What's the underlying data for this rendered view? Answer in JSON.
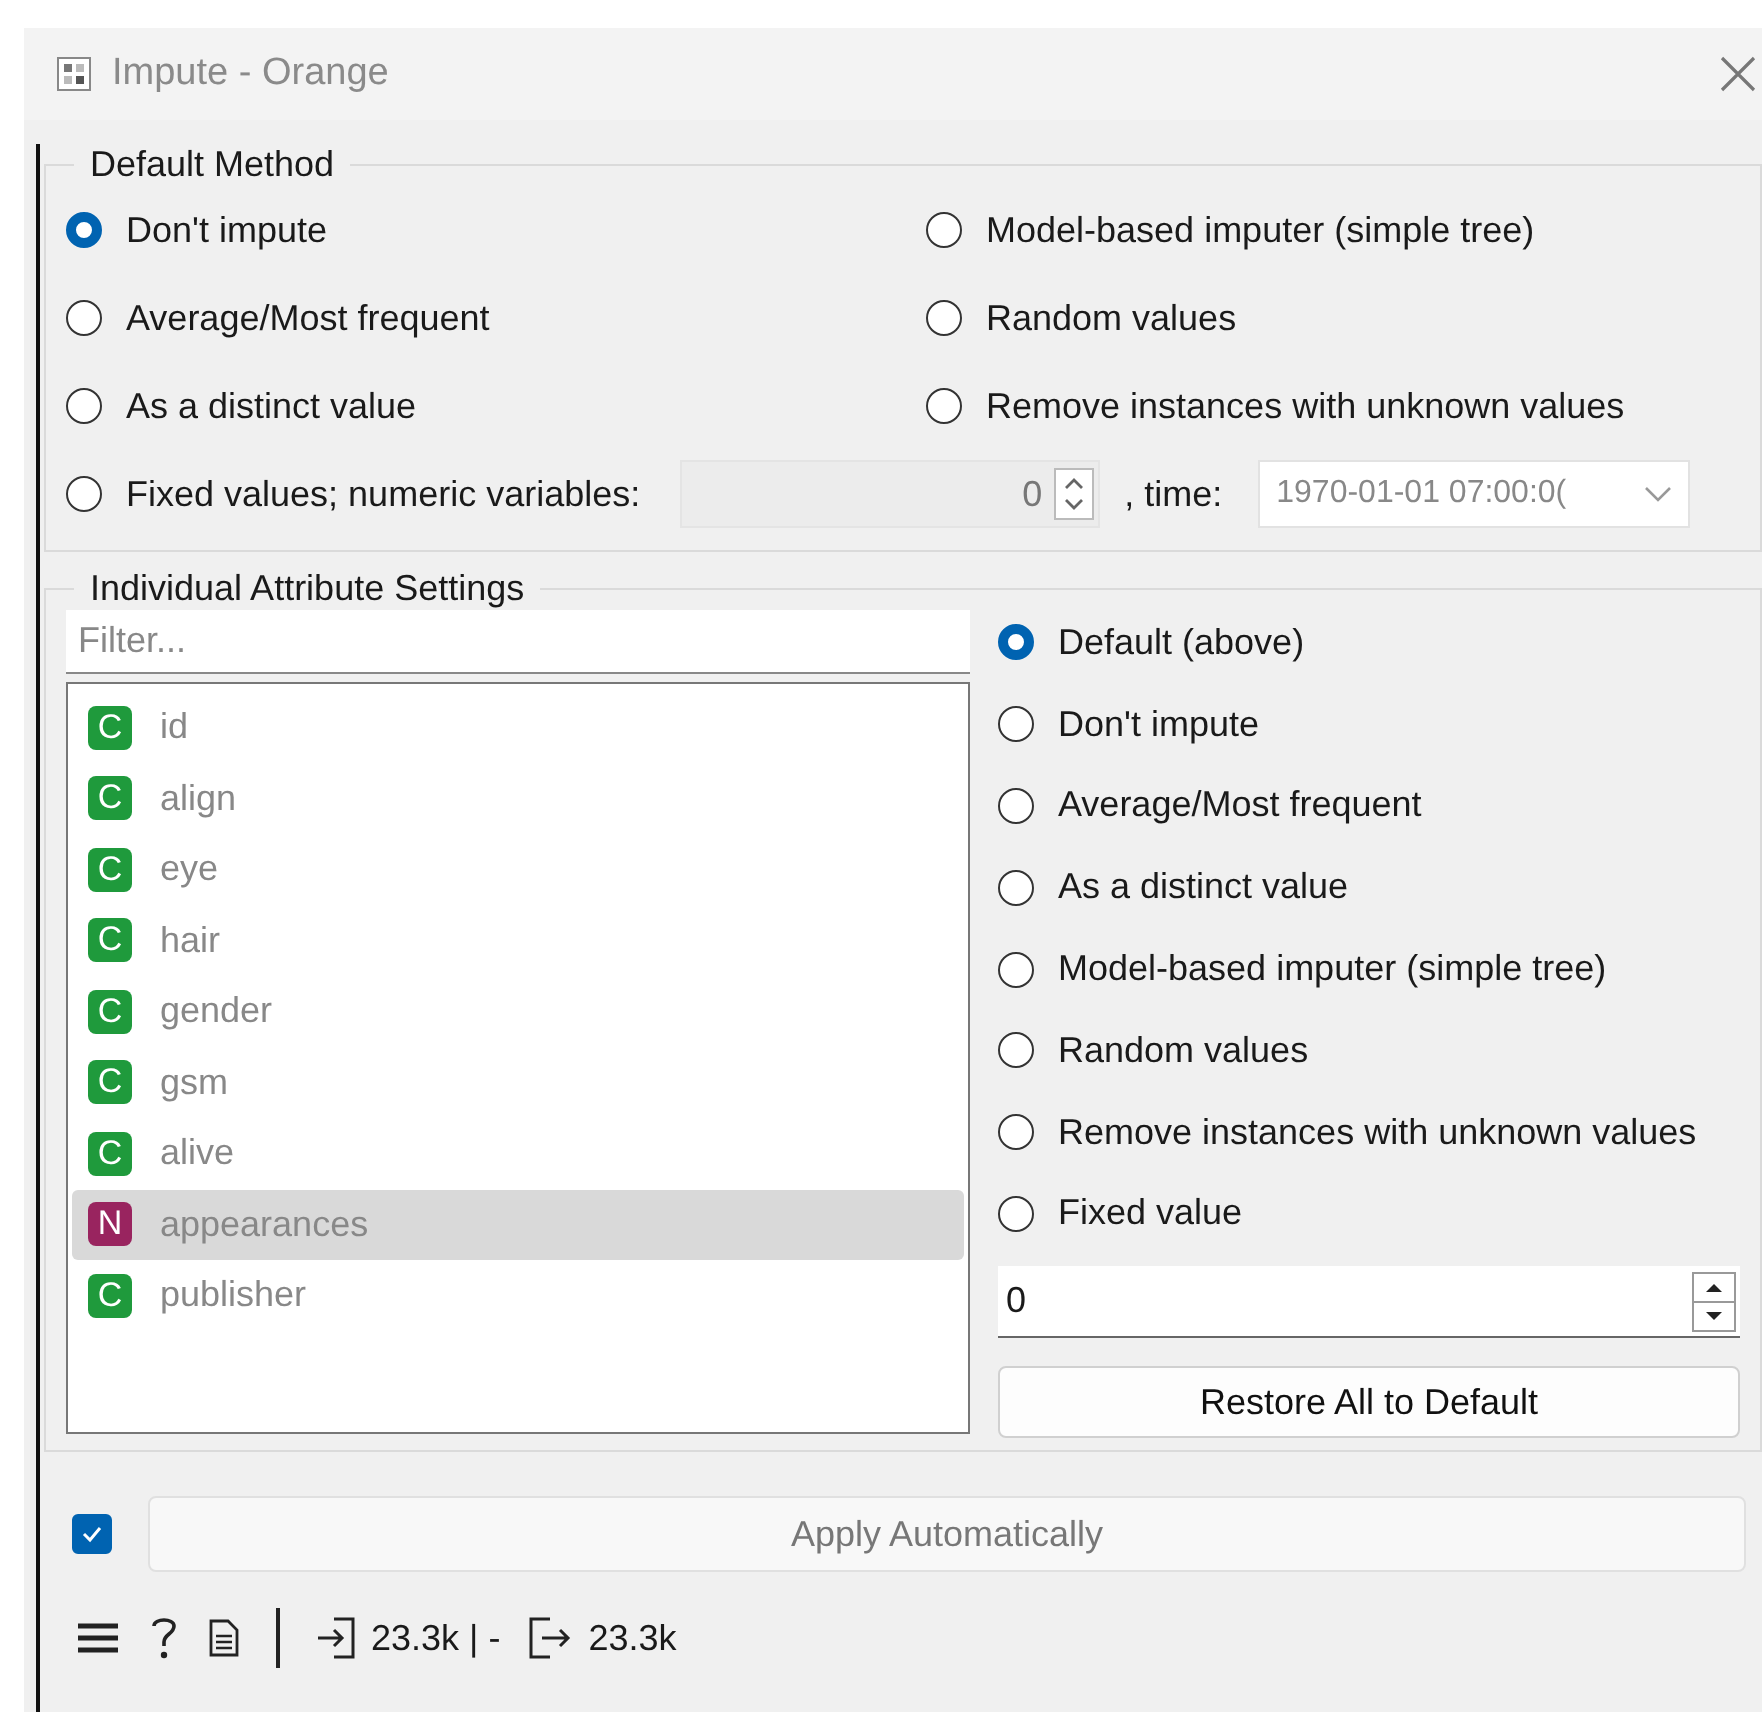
{
  "window": {
    "title": "Impute - Orange"
  },
  "default_method": {
    "title": "Default Method",
    "options": [
      {
        "label": "Don't impute",
        "selected": true
      },
      {
        "label": "Model-based imputer (simple tree)",
        "selected": false
      },
      {
        "label": "Average/Most frequent",
        "selected": false
      },
      {
        "label": "Random values",
        "selected": false
      },
      {
        "label": "As a distinct value",
        "selected": false
      },
      {
        "label": "Remove instances with unknown values",
        "selected": false
      }
    ],
    "fixed": {
      "label": "Fixed values; numeric variables:",
      "selected": false,
      "numeric_value": "0",
      "numeric_disabled": true,
      "time_label": ", time:",
      "time_value": "1970-01-01 07:00:0(",
      "time_disabled": true
    }
  },
  "individual": {
    "title": "Individual Attribute Settings",
    "filter": {
      "placeholder": "Filter..."
    },
    "attributes": [
      {
        "type": "C",
        "color": "#1f9a3c",
        "name": "id",
        "selected": false
      },
      {
        "type": "C",
        "color": "#1f9a3c",
        "name": "align",
        "selected": false
      },
      {
        "type": "C",
        "color": "#1f9a3c",
        "name": "eye",
        "selected": false
      },
      {
        "type": "C",
        "color": "#1f9a3c",
        "name": "hair",
        "selected": false
      },
      {
        "type": "C",
        "color": "#1f9a3c",
        "name": "gender",
        "selected": false
      },
      {
        "type": "C",
        "color": "#1f9a3c",
        "name": "gsm",
        "selected": false
      },
      {
        "type": "C",
        "color": "#1f9a3c",
        "name": "alive",
        "selected": false
      },
      {
        "type": "N",
        "color": "#99245f",
        "name": "appearances",
        "selected": true
      },
      {
        "type": "C",
        "color": "#1f9a3c",
        "name": "publisher",
        "selected": false
      }
    ],
    "options": [
      {
        "label": "Default (above)",
        "selected": true
      },
      {
        "label": "Don't impute",
        "selected": false
      },
      {
        "label": "Average/Most frequent",
        "selected": false
      },
      {
        "label": "As a distinct value",
        "selected": false
      },
      {
        "label": "Model-based imputer (simple tree)",
        "selected": false
      },
      {
        "label": "Random values",
        "selected": false
      },
      {
        "label": "Remove instances with unknown values",
        "selected": false
      },
      {
        "label": "Fixed value",
        "selected": false
      }
    ],
    "fixed_value": "0",
    "restore_button": "Restore All to Default"
  },
  "apply": {
    "auto_checked": true,
    "label": "Apply Automatically",
    "disabled": true
  },
  "status_bar": {
    "input": "23.3k | -",
    "output": "23.3k"
  }
}
